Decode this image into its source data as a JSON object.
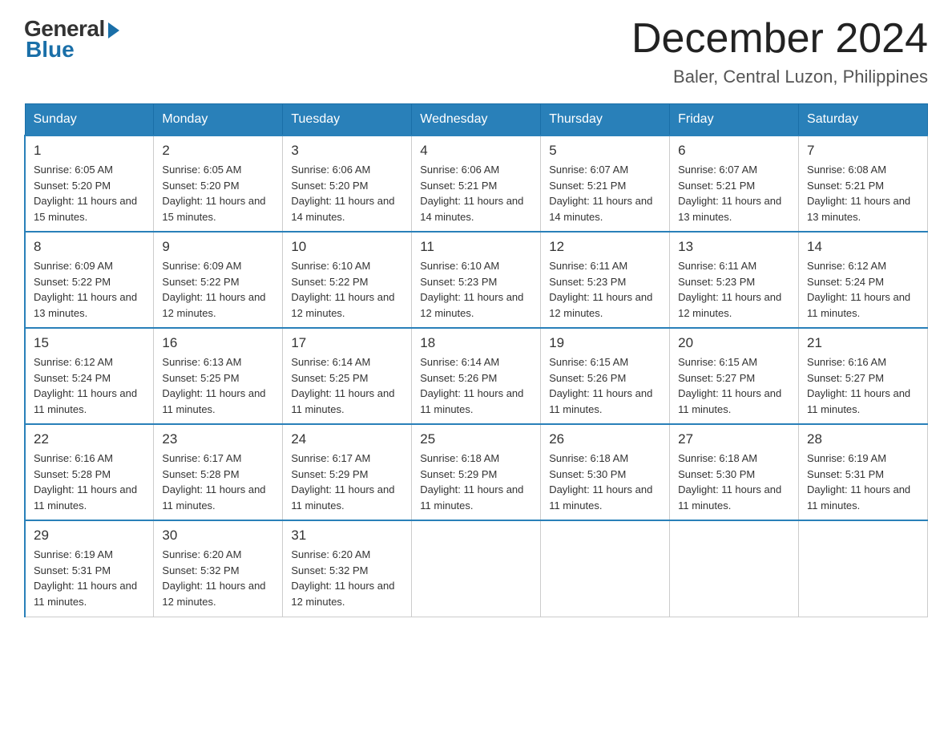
{
  "logo": {
    "general": "General",
    "blue": "Blue"
  },
  "title": {
    "month_year": "December 2024",
    "location": "Baler, Central Luzon, Philippines"
  },
  "headers": [
    "Sunday",
    "Monday",
    "Tuesday",
    "Wednesday",
    "Thursday",
    "Friday",
    "Saturday"
  ],
  "weeks": [
    [
      {
        "day": "1",
        "sunrise": "6:05 AM",
        "sunset": "5:20 PM",
        "daylight": "11 hours and 15 minutes."
      },
      {
        "day": "2",
        "sunrise": "6:05 AM",
        "sunset": "5:20 PM",
        "daylight": "11 hours and 15 minutes."
      },
      {
        "day": "3",
        "sunrise": "6:06 AM",
        "sunset": "5:20 PM",
        "daylight": "11 hours and 14 minutes."
      },
      {
        "day": "4",
        "sunrise": "6:06 AM",
        "sunset": "5:21 PM",
        "daylight": "11 hours and 14 minutes."
      },
      {
        "day": "5",
        "sunrise": "6:07 AM",
        "sunset": "5:21 PM",
        "daylight": "11 hours and 14 minutes."
      },
      {
        "day": "6",
        "sunrise": "6:07 AM",
        "sunset": "5:21 PM",
        "daylight": "11 hours and 13 minutes."
      },
      {
        "day": "7",
        "sunrise": "6:08 AM",
        "sunset": "5:21 PM",
        "daylight": "11 hours and 13 minutes."
      }
    ],
    [
      {
        "day": "8",
        "sunrise": "6:09 AM",
        "sunset": "5:22 PM",
        "daylight": "11 hours and 13 minutes."
      },
      {
        "day": "9",
        "sunrise": "6:09 AM",
        "sunset": "5:22 PM",
        "daylight": "11 hours and 12 minutes."
      },
      {
        "day": "10",
        "sunrise": "6:10 AM",
        "sunset": "5:22 PM",
        "daylight": "11 hours and 12 minutes."
      },
      {
        "day": "11",
        "sunrise": "6:10 AM",
        "sunset": "5:23 PM",
        "daylight": "11 hours and 12 minutes."
      },
      {
        "day": "12",
        "sunrise": "6:11 AM",
        "sunset": "5:23 PM",
        "daylight": "11 hours and 12 minutes."
      },
      {
        "day": "13",
        "sunrise": "6:11 AM",
        "sunset": "5:23 PM",
        "daylight": "11 hours and 12 minutes."
      },
      {
        "day": "14",
        "sunrise": "6:12 AM",
        "sunset": "5:24 PM",
        "daylight": "11 hours and 11 minutes."
      }
    ],
    [
      {
        "day": "15",
        "sunrise": "6:12 AM",
        "sunset": "5:24 PM",
        "daylight": "11 hours and 11 minutes."
      },
      {
        "day": "16",
        "sunrise": "6:13 AM",
        "sunset": "5:25 PM",
        "daylight": "11 hours and 11 minutes."
      },
      {
        "day": "17",
        "sunrise": "6:14 AM",
        "sunset": "5:25 PM",
        "daylight": "11 hours and 11 minutes."
      },
      {
        "day": "18",
        "sunrise": "6:14 AM",
        "sunset": "5:26 PM",
        "daylight": "11 hours and 11 minutes."
      },
      {
        "day": "19",
        "sunrise": "6:15 AM",
        "sunset": "5:26 PM",
        "daylight": "11 hours and 11 minutes."
      },
      {
        "day": "20",
        "sunrise": "6:15 AM",
        "sunset": "5:27 PM",
        "daylight": "11 hours and 11 minutes."
      },
      {
        "day": "21",
        "sunrise": "6:16 AM",
        "sunset": "5:27 PM",
        "daylight": "11 hours and 11 minutes."
      }
    ],
    [
      {
        "day": "22",
        "sunrise": "6:16 AM",
        "sunset": "5:28 PM",
        "daylight": "11 hours and 11 minutes."
      },
      {
        "day": "23",
        "sunrise": "6:17 AM",
        "sunset": "5:28 PM",
        "daylight": "11 hours and 11 minutes."
      },
      {
        "day": "24",
        "sunrise": "6:17 AM",
        "sunset": "5:29 PM",
        "daylight": "11 hours and 11 minutes."
      },
      {
        "day": "25",
        "sunrise": "6:18 AM",
        "sunset": "5:29 PM",
        "daylight": "11 hours and 11 minutes."
      },
      {
        "day": "26",
        "sunrise": "6:18 AM",
        "sunset": "5:30 PM",
        "daylight": "11 hours and 11 minutes."
      },
      {
        "day": "27",
        "sunrise": "6:18 AM",
        "sunset": "5:30 PM",
        "daylight": "11 hours and 11 minutes."
      },
      {
        "day": "28",
        "sunrise": "6:19 AM",
        "sunset": "5:31 PM",
        "daylight": "11 hours and 11 minutes."
      }
    ],
    [
      {
        "day": "29",
        "sunrise": "6:19 AM",
        "sunset": "5:31 PM",
        "daylight": "11 hours and 11 minutes."
      },
      {
        "day": "30",
        "sunrise": "6:20 AM",
        "sunset": "5:32 PM",
        "daylight": "11 hours and 12 minutes."
      },
      {
        "day": "31",
        "sunrise": "6:20 AM",
        "sunset": "5:32 PM",
        "daylight": "11 hours and 12 minutes."
      },
      null,
      null,
      null,
      null
    ]
  ]
}
